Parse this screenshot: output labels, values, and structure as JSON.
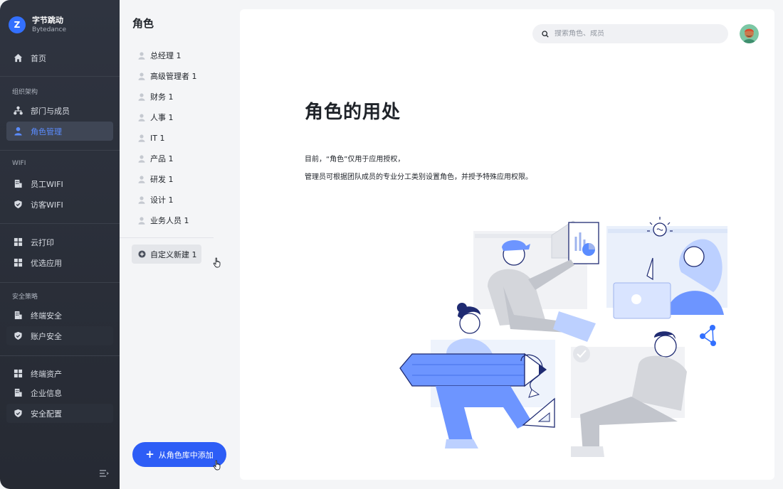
{
  "org": {
    "initial": "Z",
    "name": "字节跳动",
    "sub": "Bytedance"
  },
  "sidebar": {
    "home": "首页",
    "groups": {
      "org": "组织架构",
      "wifi": "WIFI",
      "security": "安全策略"
    },
    "items": {
      "dept": "部门与成员",
      "roles": "角色管理",
      "staff_wifi": "员工WIFI",
      "guest_wifi": "访客WIFI",
      "cloud_print": "云打印",
      "apps": "优选应用",
      "device_sec": "终端安全",
      "account_sec": "账户安全",
      "assets": "终端资产",
      "company": "企业信息",
      "sec_config": "安全配置"
    }
  },
  "roles": {
    "title": "角色",
    "list": [
      "总经理 1",
      "高级管理者 1",
      "财务 1",
      "人事 1",
      "IT 1",
      "产品 1",
      "研发 1",
      "设计 1",
      "业务人员 1"
    ],
    "custom": "自定义新建 1",
    "add_button": "从角色库中添加"
  },
  "main": {
    "search_placeholder": "搜索角色、成员",
    "heading": "角色的用处",
    "desc_line1": "目前，“角色”仅用于应用授权，",
    "desc_line2": "管理员可根据团队成员的专业分工类别设置角色，并授予特殊应用权限。"
  },
  "colors": {
    "sidebar_bg": "#2f3440",
    "accent": "#2d5df6",
    "active_text": "#5b8cff"
  }
}
